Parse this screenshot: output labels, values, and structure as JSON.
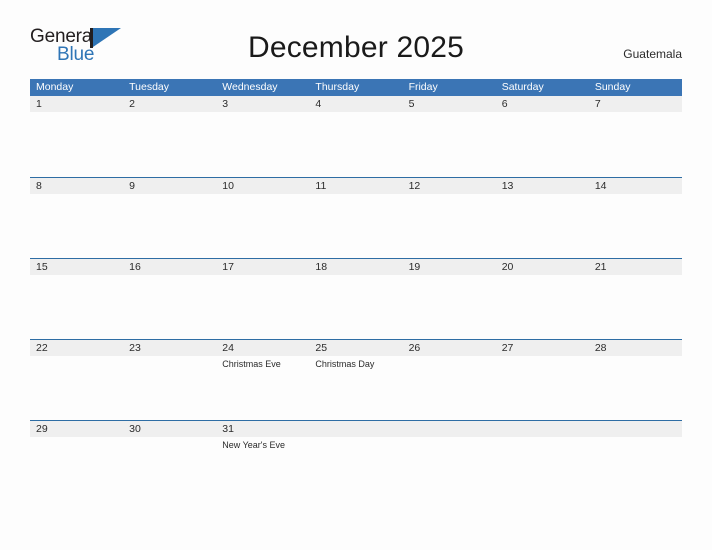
{
  "brand": {
    "name_part1": "General",
    "name_part2": "Blue",
    "mark_icon": "triangle-flag-icon",
    "accent_color": "#2e75b6"
  },
  "header": {
    "title": "December 2025",
    "country": "Guatemala"
  },
  "theme": {
    "header_blue": "#3b75b5",
    "separator_blue": "#2e6da4",
    "band_gray": "#efefef",
    "page_background": "#fdfdfd",
    "text_color": "#2b2b2b"
  },
  "calendar": {
    "weekday_headers": [
      "Monday",
      "Tuesday",
      "Wednesday",
      "Thursday",
      "Friday",
      "Saturday",
      "Sunday"
    ],
    "weeks": [
      [
        {
          "day": "1",
          "events": []
        },
        {
          "day": "2",
          "events": []
        },
        {
          "day": "3",
          "events": []
        },
        {
          "day": "4",
          "events": []
        },
        {
          "day": "5",
          "events": []
        },
        {
          "day": "6",
          "events": []
        },
        {
          "day": "7",
          "events": []
        }
      ],
      [
        {
          "day": "8",
          "events": []
        },
        {
          "day": "9",
          "events": []
        },
        {
          "day": "10",
          "events": []
        },
        {
          "day": "11",
          "events": []
        },
        {
          "day": "12",
          "events": []
        },
        {
          "day": "13",
          "events": []
        },
        {
          "day": "14",
          "events": []
        }
      ],
      [
        {
          "day": "15",
          "events": []
        },
        {
          "day": "16",
          "events": []
        },
        {
          "day": "17",
          "events": []
        },
        {
          "day": "18",
          "events": []
        },
        {
          "day": "19",
          "events": []
        },
        {
          "day": "20",
          "events": []
        },
        {
          "day": "21",
          "events": []
        }
      ],
      [
        {
          "day": "22",
          "events": []
        },
        {
          "day": "23",
          "events": []
        },
        {
          "day": "24",
          "events": [
            "Christmas Eve"
          ]
        },
        {
          "day": "25",
          "events": [
            "Christmas Day"
          ]
        },
        {
          "day": "26",
          "events": []
        },
        {
          "day": "27",
          "events": []
        },
        {
          "day": "28",
          "events": []
        }
      ],
      [
        {
          "day": "29",
          "events": []
        },
        {
          "day": "30",
          "events": []
        },
        {
          "day": "31",
          "events": [
            "New Year's Eve"
          ]
        },
        {
          "day": "",
          "events": []
        },
        {
          "day": "",
          "events": []
        },
        {
          "day": "",
          "events": []
        },
        {
          "day": "",
          "events": []
        }
      ]
    ]
  }
}
